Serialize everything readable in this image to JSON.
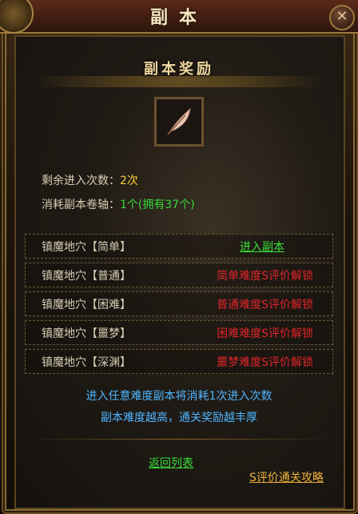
{
  "window": {
    "title": "副本",
    "close_symbol": "✕"
  },
  "reward": {
    "title": "副本奖励",
    "item_icon": "feather-icon"
  },
  "info": {
    "remaining_label": "剩余进入次数：",
    "remaining_value": "2次",
    "cost_label": "消耗副本卷轴：",
    "cost_value": "1个",
    "owned": "(拥有37个)"
  },
  "difficulties": [
    {
      "name": "镇魔地穴【简单】",
      "action": "进入副本"
    },
    {
      "name": "镇魔地穴【普通】",
      "action": "简单难度S评价解锁"
    },
    {
      "name": "镇魔地穴【困难】",
      "action": "普通难度S评价解锁"
    },
    {
      "name": "镇魔地穴【噩梦】",
      "action": "困难难度S评价解锁"
    },
    {
      "name": "镇魔地穴【深渊】",
      "action": "噩梦难度S评价解锁"
    }
  ],
  "notes": [
    "进入任意难度副本将消耗1次进入次数",
    "副本难度越高，通关奖励越丰厚"
  ],
  "footer": {
    "back_label": "返回列表",
    "guide_label": "S评价通关攻略"
  },
  "colors": {
    "green": "#39d93a",
    "red": "#e0252a",
    "blue": "#4fb6ff",
    "gold": "#f0b43a"
  }
}
